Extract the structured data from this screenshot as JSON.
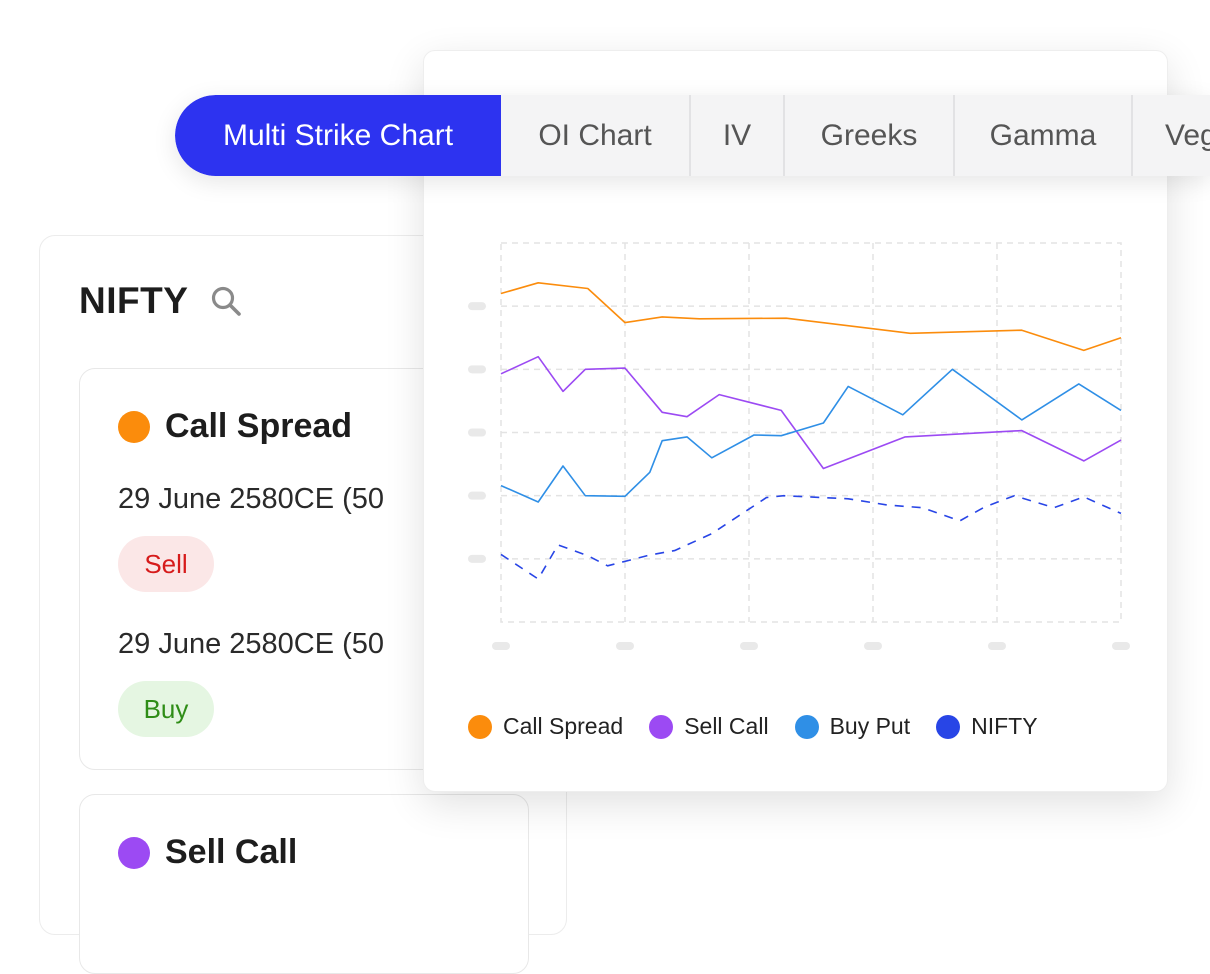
{
  "tabs": [
    {
      "label": "Multi Strike Chart",
      "active": true
    },
    {
      "label": "OI Chart",
      "active": false
    },
    {
      "label": "IV",
      "active": false
    },
    {
      "label": "Greeks",
      "active": false
    },
    {
      "label": "Gamma",
      "active": false
    },
    {
      "label": "Vega",
      "active": false
    }
  ],
  "symbol": {
    "name": "NIFTY",
    "search_icon": "search-icon"
  },
  "strategies": [
    {
      "name": "Call Spread",
      "color": "#fb8c0c",
      "legs": [
        {
          "contract": "29 June 2580CE (50",
          "side": "Sell"
        },
        {
          "contract": "29 June 2580CE (50",
          "side": "Buy"
        }
      ]
    },
    {
      "name": "Sell Call",
      "color": "#9c4af3"
    }
  ],
  "colors": {
    "accent": "#2d33f0",
    "sell_text": "#d61b1b",
    "sell_bg": "#fbe7e7",
    "buy_text": "#2f8d17",
    "buy_bg": "#e5f6e2"
  },
  "chart_data": {
    "type": "line",
    "grid": true,
    "legend_position": "bottom",
    "tick_labels_visible": false,
    "xlim": [
      0,
      25
    ],
    "ylim": [
      0,
      6
    ],
    "series": [
      {
        "name": "Call Spread",
        "color": "#fb8c0c",
        "style": "solid",
        "x": [
          0,
          1.5,
          3.5,
          5,
          6.5,
          8,
          11.5,
          16.5,
          21,
          23.5,
          25
        ],
        "y": [
          5.2,
          5.37,
          5.28,
          4.74,
          4.83,
          4.8,
          4.81,
          4.57,
          4.62,
          4.3,
          4.5
        ]
      },
      {
        "name": "Sell Call",
        "color": "#9c4af3",
        "style": "solid",
        "x": [
          0,
          1.5,
          2.5,
          3.4,
          5,
          6.5,
          7.5,
          8.8,
          11.3,
          13,
          16.3,
          21,
          23.5,
          25
        ],
        "y": [
          3.93,
          4.2,
          3.65,
          4.0,
          4.02,
          3.32,
          3.25,
          3.6,
          3.35,
          2.43,
          2.93,
          3.03,
          2.55,
          2.88
        ]
      },
      {
        "name": "Buy Put",
        "color": "#2f8fe6",
        "style": "solid",
        "x": [
          0,
          1.5,
          2.5,
          3.4,
          5,
          6,
          6.5,
          7.5,
          8.5,
          10.2,
          11.3,
          13,
          14,
          16.2,
          18.2,
          21,
          23.3,
          25
        ],
        "y": [
          2.16,
          1.9,
          2.47,
          2.0,
          1.99,
          2.37,
          2.87,
          2.93,
          2.6,
          2.96,
          2.95,
          3.15,
          3.73,
          3.28,
          4.0,
          3.2,
          3.77,
          3.35
        ]
      },
      {
        "name": "NIFTY",
        "color": "#2845e6",
        "style": "dashed",
        "x": [
          0,
          1.5,
          2.3,
          3.5,
          4.3,
          6,
          7,
          8.5,
          10.7,
          11.4,
          14,
          15.6,
          17,
          18.5,
          19.5,
          20.7,
          22.3,
          23.5,
          25
        ],
        "y": [
          1.07,
          0.68,
          1.22,
          1.05,
          0.89,
          1.06,
          1.13,
          1.4,
          1.97,
          2.0,
          1.95,
          1.85,
          1.81,
          1.6,
          1.82,
          2.0,
          1.81,
          1.98,
          1.72
        ]
      }
    ]
  }
}
